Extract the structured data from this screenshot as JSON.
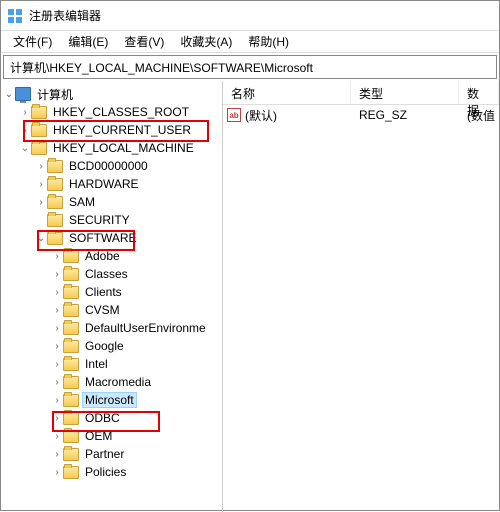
{
  "window": {
    "title": "注册表编辑器"
  },
  "menu": {
    "file": "文件(F)",
    "edit": "编辑(E)",
    "view": "查看(V)",
    "favorites": "收藏夹(A)",
    "help": "帮助(H)"
  },
  "address": {
    "path": "计算机\\HKEY_LOCAL_MACHINE\\SOFTWARE\\Microsoft"
  },
  "tree": {
    "root": "计算机",
    "hkcr": "HKEY_CLASSES_ROOT",
    "hkcu": "HKEY_CURRENT_USER",
    "hklm": "HKEY_LOCAL_MACHINE",
    "hklm_children": {
      "bcd": "BCD00000000",
      "hardware": "HARDWARE",
      "sam": "SAM",
      "security": "SECURITY",
      "software": "SOFTWARE"
    },
    "software_children": {
      "adobe": "Adobe",
      "classes": "Classes",
      "clients": "Clients",
      "cvsm": "CVSM",
      "defaultuser": "DefaultUserEnvironme",
      "google": "Google",
      "intel": "Intel",
      "macromedia": "Macromedia",
      "microsoft": "Microsoft",
      "odbc": "ODBC",
      "oem": "OEM",
      "partner": "Partner",
      "policies": "Policies"
    }
  },
  "list": {
    "headers": {
      "name": "名称",
      "type": "类型",
      "data": "数据"
    },
    "rows": [
      {
        "icon": "ab",
        "name": "(默认)",
        "type": "REG_SZ",
        "data": "(数值"
      }
    ]
  }
}
